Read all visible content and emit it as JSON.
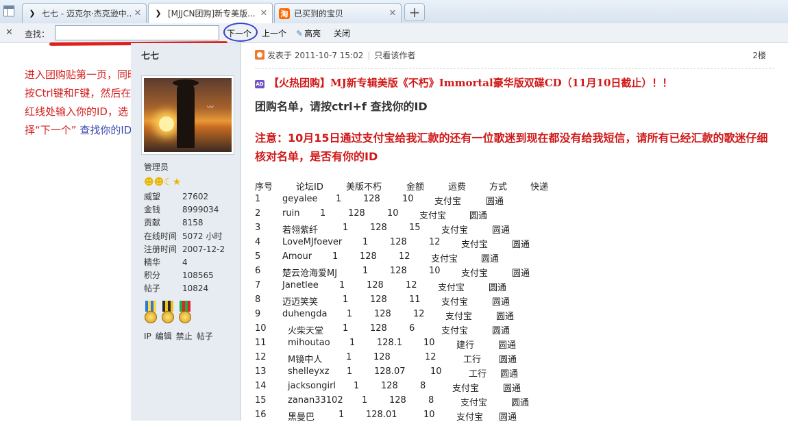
{
  "tabs": [
    {
      "label": "七七 - 迈克尔·杰克逊中...",
      "icon": "mjcn-icon",
      "active": false
    },
    {
      "label": "[MJJCN团购]新专美版...",
      "icon": "mjcn-icon",
      "active": true
    },
    {
      "label": "已买到的宝贝",
      "icon": "taobao-icon",
      "active": false
    }
  ],
  "findbar": {
    "label": "查找：",
    "value": "",
    "next": "下一个",
    "prev": "上一个",
    "highlight": "高亮",
    "close": "关闭"
  },
  "annotation": {
    "red": "进入团购贴第一页，同时按Ctrl键和F键，然后在红线处输入你的ID，选择“下一个”",
    "blue": "查找你的ID"
  },
  "author": {
    "name": "七七",
    "role": "管理员",
    "stats": [
      {
        "key": "威望",
        "value": "27602"
      },
      {
        "key": "金钱",
        "value": "8999034"
      },
      {
        "key": "贡献",
        "value": "8158"
      },
      {
        "key": "在线时间",
        "value": "5072 小时"
      },
      {
        "key": "注册时间",
        "value": "2007-12-2"
      },
      {
        "key": "精华",
        "value": "4"
      },
      {
        "key": "积分",
        "value": "108565"
      },
      {
        "key": "帖子",
        "value": "10824"
      }
    ],
    "actions": [
      "IP",
      "编辑",
      "禁止",
      "帖子"
    ]
  },
  "post": {
    "posted_prefix": "发表于",
    "posted_time": "2011-10-7 15:02",
    "only_author": "只看该作者",
    "floor": "2楼",
    "ad_badge": "AD",
    "title": "【火热团购】MJ新专辑美版《不朽》Immortal豪华版双碟CD（11月10日截止）！！",
    "subtitle": "团购名单，请按ctrl+f 查找你的ID",
    "notice": "注意：10月15日通过支付宝给我汇款的还有一位歌迷到现在都没有给我短信，请所有已经汇款的歌迷仔细核对名单，是否有你的ID",
    "table_headers": [
      "序号",
      "论坛ID",
      "美版不朽",
      "金额",
      "运费",
      "方式",
      "快递"
    ],
    "table_rows": [
      [
        "1",
        "geyalee",
        "1",
        "128",
        "10",
        "支付宝",
        "圆通"
      ],
      [
        "2",
        "ruin",
        "1",
        "128",
        "10",
        "支付宝",
        "圆通"
      ],
      [
        "3",
        "若翎紫纤",
        "1",
        "128",
        "15",
        "支付宝",
        "圆通"
      ],
      [
        "4",
        "LoveMJfoever",
        "1",
        "128",
        "12",
        "支付宝",
        "圆通"
      ],
      [
        "5",
        "Amour",
        "1",
        "128",
        "12",
        "支付宝",
        "圆通"
      ],
      [
        "6",
        "楚云沧海爱MJ",
        "1",
        "128",
        "10",
        "支付宝",
        "圆通"
      ],
      [
        "7",
        "Janetlee",
        "1",
        "128",
        "12",
        "支付宝",
        "圆通"
      ],
      [
        "8",
        "迈迈笑笑",
        "1",
        "128",
        "11",
        "支付宝",
        "圆通"
      ],
      [
        "9",
        "duhengda",
        "1",
        "128",
        "12",
        "支付宝",
        "圆通"
      ],
      [
        "10",
        "火柴天堂",
        "1",
        "128",
        "6",
        "支付宝",
        "圆通"
      ],
      [
        "11",
        "mihoutao",
        "1",
        "128.1",
        "10",
        "建行",
        "圆通"
      ],
      [
        "12",
        "M镜中人",
        "1",
        "128",
        "12",
        "工行",
        "圆通"
      ],
      [
        "13",
        "shelleyxz",
        "1",
        "128.07",
        "10",
        "工行",
        "圆通"
      ],
      [
        "14",
        "jacksongirl",
        "1",
        "128",
        "8",
        "支付宝",
        "圆通"
      ],
      [
        "15",
        "zanan33102",
        "1",
        "128",
        "8",
        "支付宝",
        "圆通"
      ],
      [
        "16",
        "黑曼巴",
        "1",
        "128.01",
        "10",
        "支付宝",
        "圆通"
      ]
    ]
  }
}
